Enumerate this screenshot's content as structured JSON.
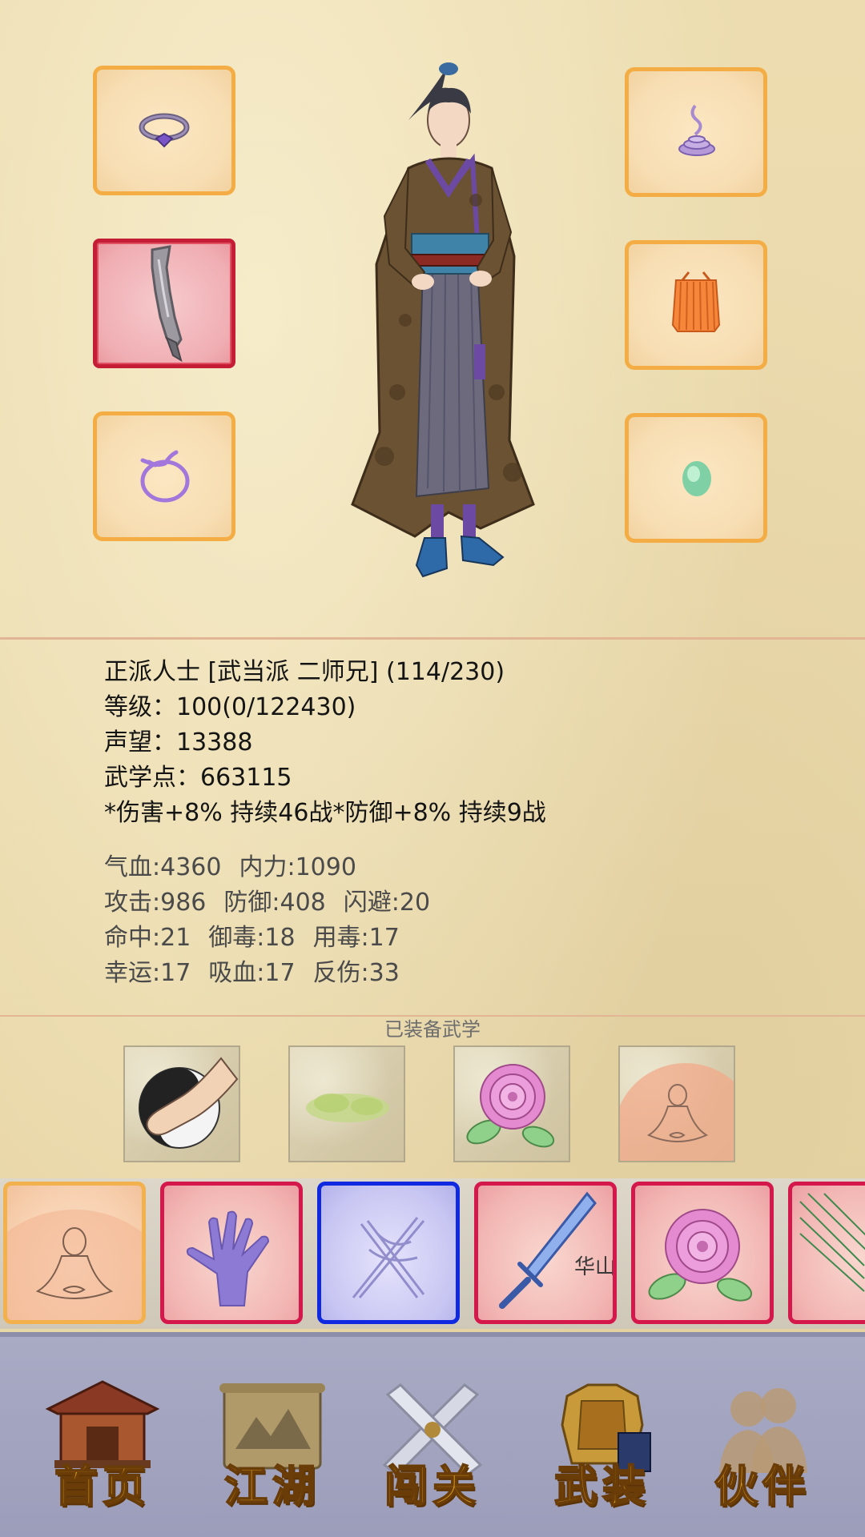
{
  "profile": {
    "title_line": "正派人士 [武当派 二师兄] (114/230)",
    "level_line": "等级：100(0/122430)",
    "prestige_line": "声望：13388",
    "martial_points_line": "武学点：663115",
    "buffs_line": "*伤害+8% 持续46战*防御+8% 持续9战"
  },
  "stats": {
    "row1": [
      "气血:4360",
      "内力:1090"
    ],
    "row2": [
      "攻击:986",
      "防御:408",
      "闪避:20"
    ],
    "row3": [
      "命中:21",
      "御毒:18",
      "用毒:17"
    ],
    "row4": [
      "幸运:17",
      "吸血:17",
      "反伤:33"
    ]
  },
  "equipped_section": {
    "label": "已装备武学"
  },
  "equipment_slots": [
    {
      "icon": "ring-icon",
      "selected": false
    },
    {
      "icon": "blade-icon",
      "selected": true
    },
    {
      "icon": "bracelet-icon",
      "selected": false
    },
    {
      "icon": "incense-icon",
      "selected": false
    },
    {
      "icon": "robe-icon",
      "selected": false
    },
    {
      "icon": "jade-icon",
      "selected": false
    }
  ],
  "equipped_skills": [
    "taiji-palm-icon",
    "green-mist-icon",
    "peony-icon",
    "meditation-icon"
  ],
  "skill_bar": [
    {
      "icon": "meditation-icon",
      "frame": "gold"
    },
    {
      "icon": "purple-hand-icon",
      "frame": "red"
    },
    {
      "icon": "crossed-swords-icon",
      "frame": "blue"
    },
    {
      "icon": "huashan-sword-icon",
      "frame": "red",
      "text": "华山"
    },
    {
      "icon": "peony-icon",
      "frame": "red"
    },
    {
      "icon": "leaves-icon",
      "frame": "red"
    }
  ],
  "nav": {
    "home": "首页",
    "jianghu": "江湖",
    "challenge": "闯关",
    "armory": "武装",
    "partner": "伙伴"
  },
  "colors": {
    "slot_border": "#f3ad44",
    "selected_border": "#c41d35",
    "card_border_red": "#d4184c",
    "card_border_blue": "#1029e0",
    "nav_background": "#a9abc5",
    "nav_label": "#e2a21c"
  }
}
